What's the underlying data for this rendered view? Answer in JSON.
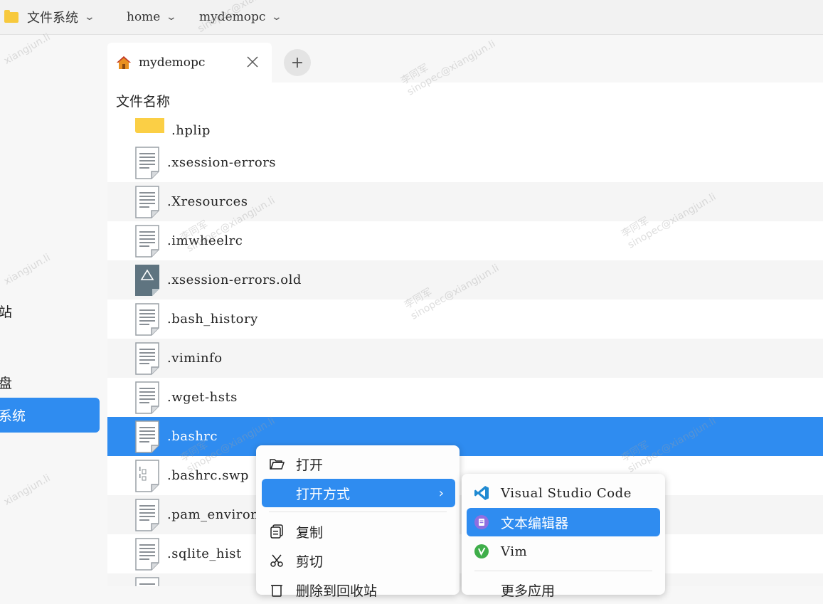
{
  "breadcrumb": {
    "root": "文件系统",
    "home": "home",
    "user": "mydemopc"
  },
  "sidebar": {
    "items": [
      "站",
      "盘"
    ],
    "selected": "系统"
  },
  "tab": {
    "label": "mydemopc",
    "add": "+"
  },
  "list": {
    "column_header": "文件名称",
    "files": [
      ".hplip",
      ".xsession-errors",
      ".Xresources",
      ".imwheelrc",
      ".xsession-errors.old",
      ".bash_history",
      ".viminfo",
      ".wget-hsts",
      ".bashrc",
      ".bashrc.swp",
      ".pam_environ",
      ".sqlite_hist",
      ""
    ]
  },
  "context_menu": {
    "open": "打开",
    "open_with": "打开方式",
    "copy": "复制",
    "cut": "剪切",
    "delete": "删除到回收站"
  },
  "open_with_menu": {
    "vscode": "Visual Studio Code",
    "text_editor": "文本编辑器",
    "vim": "Vim",
    "more": "更多应用"
  },
  "watermark": {
    "name": "李同军",
    "email": "sinopec@xiangjun.li",
    "short": "xiangjun.li"
  },
  "colors": {
    "accent": "#2f8cf0",
    "folder": "#f7c93d"
  }
}
